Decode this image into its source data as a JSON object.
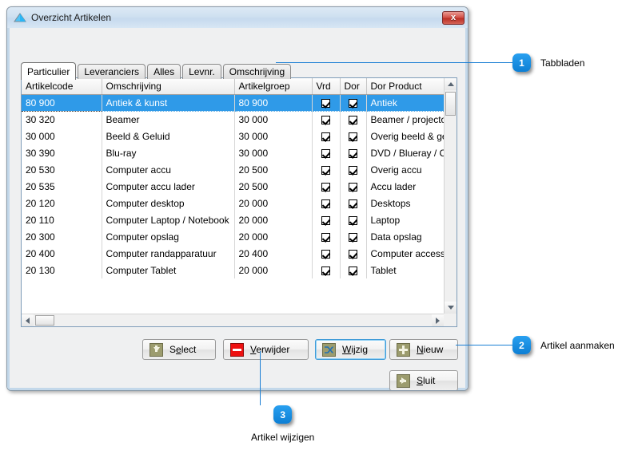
{
  "window": {
    "title": "Overzicht Artikelen",
    "icon": "triangle-icon",
    "close_label": "x"
  },
  "tabs": [
    {
      "label": "Particulier",
      "active": true
    },
    {
      "label": "Leveranciers",
      "active": false
    },
    {
      "label": "Alles",
      "active": false
    },
    {
      "label": "Levnr.",
      "active": false
    },
    {
      "label": "Omschrijving",
      "active": false
    }
  ],
  "grid": {
    "columns": [
      "Artikelcode",
      "Omschrijving",
      "Artikelgroep",
      "Vrd",
      "Dor",
      "Dor Product"
    ],
    "rows": [
      {
        "artikelcode": "80 900",
        "omschrijving": "Antiek & kunst",
        "artikelgroep": "80 900",
        "vrd": true,
        "dor": true,
        "dor_product": "Antiek",
        "selected": true
      },
      {
        "artikelcode": "30 320",
        "omschrijving": "Beamer",
        "artikelgroep": "30 000",
        "vrd": true,
        "dor": true,
        "dor_product": "Beamer / projector",
        "selected": false
      },
      {
        "artikelcode": "30 000",
        "omschrijving": "Beeld & Geluid",
        "artikelgroep": "30 000",
        "vrd": true,
        "dor": true,
        "dor_product": "Overig beeld & geluid",
        "selected": false
      },
      {
        "artikelcode": "30 390",
        "omschrijving": "Blu-ray",
        "artikelgroep": "30 000",
        "vrd": true,
        "dor": true,
        "dor_product": "DVD / Blueray / CD",
        "selected": false
      },
      {
        "artikelcode": "20 530",
        "omschrijving": "Computer accu",
        "artikelgroep": "20 500",
        "vrd": true,
        "dor": true,
        "dor_product": "Overig accu",
        "selected": false
      },
      {
        "artikelcode": "20 535",
        "omschrijving": "Computer accu lader",
        "artikelgroep": "20 500",
        "vrd": true,
        "dor": true,
        "dor_product": "Accu lader",
        "selected": false
      },
      {
        "artikelcode": "20 120",
        "omschrijving": "Computer desktop",
        "artikelgroep": "20 000",
        "vrd": true,
        "dor": true,
        "dor_product": "Desktops",
        "selected": false
      },
      {
        "artikelcode": "20 110",
        "omschrijving": "Computer Laptop / Notebook",
        "artikelgroep": "20 000",
        "vrd": true,
        "dor": true,
        "dor_product": "Laptop",
        "selected": false
      },
      {
        "artikelcode": "20 300",
        "omschrijving": "Computer opslag",
        "artikelgroep": "20 000",
        "vrd": true,
        "dor": true,
        "dor_product": "Data opslag",
        "selected": false
      },
      {
        "artikelcode": "20 400",
        "omschrijving": "Computer randapparatuur",
        "artikelgroep": "20 400",
        "vrd": true,
        "dor": true,
        "dor_product": "Computer accessoires",
        "selected": false
      },
      {
        "artikelcode": "20 130",
        "omschrijving": "Computer Tablet",
        "artikelgroep": "20 000",
        "vrd": true,
        "dor": true,
        "dor_product": "Tablet",
        "selected": false
      }
    ]
  },
  "buttons": {
    "select": {
      "label_pre": "S",
      "label_key": "e",
      "label_post": "lect",
      "icon": "down-arrow-icon"
    },
    "verwijder": {
      "label_pre": "",
      "label_key": "V",
      "label_post": "erwijder",
      "icon": "minus-icon"
    },
    "wijzig": {
      "label_pre": "",
      "label_key": "W",
      "label_post": "ijzig",
      "icon": "shuffle-icon",
      "focused": true
    },
    "nieuw": {
      "label_pre": "",
      "label_key": "N",
      "label_post": "ieuw",
      "icon": "plus-icon"
    },
    "sluit": {
      "label_pre": "",
      "label_key": "S",
      "label_post": "luit",
      "icon": "right-arrow-icon"
    }
  },
  "callouts": [
    {
      "number": "1",
      "text": "Tabbladen"
    },
    {
      "number": "2",
      "text": "Artikel aanmaken"
    },
    {
      "number": "3",
      "text": "Artikel wijzigen"
    }
  ],
  "colors": {
    "accent": "#1b7fd4",
    "selection": "#2f9ae8",
    "icon_olive": "#9c9c6e",
    "delete_red": "#ee1111"
  }
}
